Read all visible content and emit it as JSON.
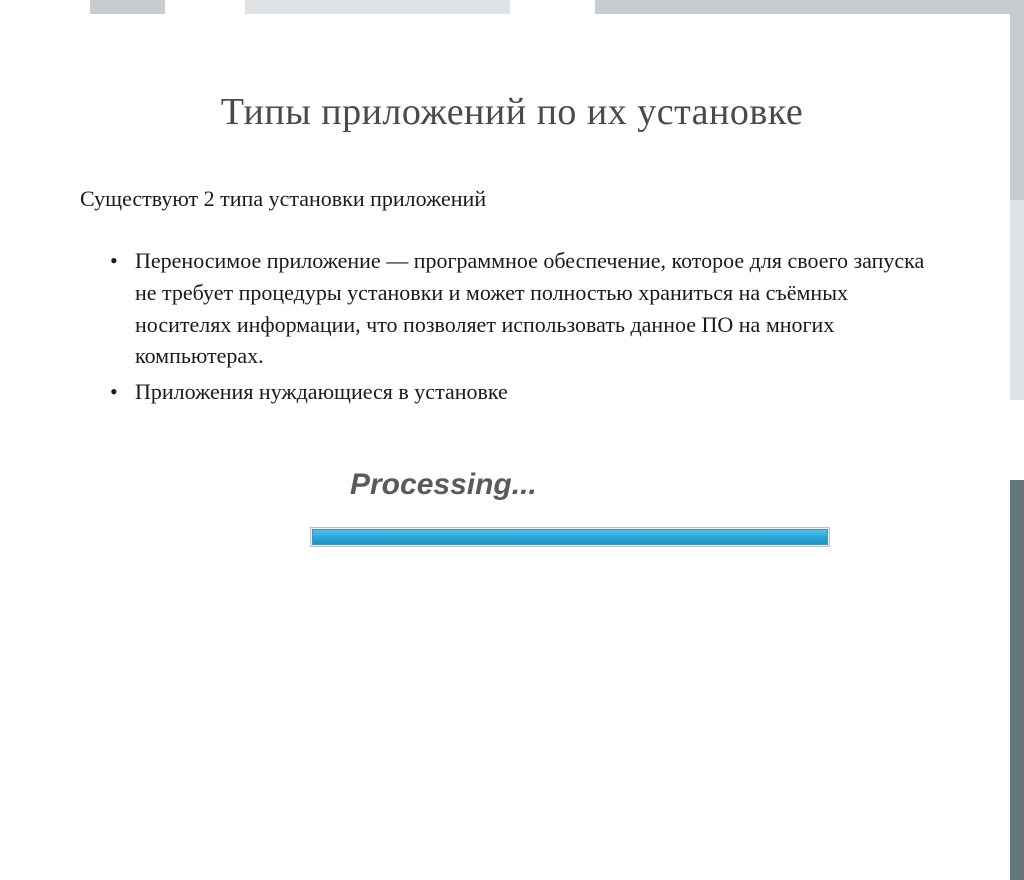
{
  "slide": {
    "title": "Типы приложений по их установке",
    "intro": "Существуют 2 типа установки приложений",
    "bullets": [
      "Переносимое приложение — программное обеспечение, которое для своего запуска не требует процедуры установки и может полностью храниться на съёмных носителях информации, что позволяет использовать данное ПО на многих компьютерах.",
      "Приложения нуждающиеся в установке"
    ],
    "processing": {
      "label": "Processing...",
      "progress_percent": 100
    }
  }
}
